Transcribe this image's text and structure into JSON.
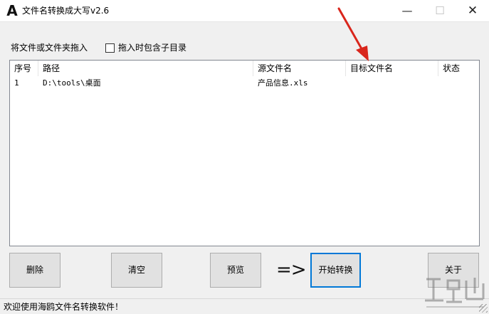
{
  "window": {
    "icon_text": "A",
    "title": "文件名转换成大写v2.6",
    "min_glyph": "—",
    "max_glyph": "☐",
    "close_glyph": "✕"
  },
  "options": {
    "drop_label": "将文件或文件夹拖入",
    "subdir_label": "拖入时包含子目录",
    "subdir_checked": false
  },
  "table": {
    "columns": [
      "序号",
      "路径",
      "源文件名",
      "目标文件名",
      "状态"
    ],
    "rows": [
      {
        "index": "1",
        "path": "D:\\tools\\桌面",
        "source": "产品信息.xls",
        "target": "",
        "status": ""
      }
    ]
  },
  "buttons": {
    "delete": "删除",
    "clear": "清空",
    "preview": "预览",
    "arrow": "=>",
    "start": "开始转换",
    "about": "关于"
  },
  "status": {
    "text": "欢迎使用海鸥文件名转换软件！"
  },
  "icons": {
    "annotation": "red-arrow-icon",
    "watermark": "site-watermark"
  },
  "colors": {
    "accent": "#0078d7",
    "annotation": "#d9261c"
  }
}
